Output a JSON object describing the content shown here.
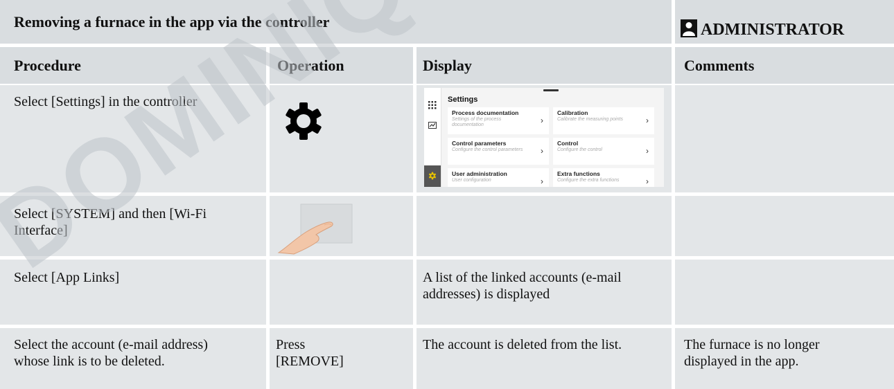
{
  "title": "Removing a furnace in the app via the controller",
  "role": {
    "label": "ADMINISTRATOR",
    "icon": "user-icon"
  },
  "columns": [
    "Procedure",
    "Operation",
    "Display",
    "Comments"
  ],
  "rows": [
    {
      "procedure": "Select [Settings] in the controller",
      "operation": "",
      "operation_icon": "gear-icon",
      "display": "",
      "comments": ""
    },
    {
      "procedure": "Select [SYSTEM] and then [Wi-Fi Interface]",
      "operation": "",
      "operation_icon": "finger-swipe-icon",
      "display": "",
      "comments": ""
    },
    {
      "procedure": "Select [App Links]",
      "operation": "",
      "display": "A list of the linked accounts (e-mail addresses) is displayed",
      "comments": ""
    },
    {
      "procedure": "Select the account (e-mail address) whose link is to be deleted.",
      "operation": "Press [REMOVE]",
      "display": "The account is deleted from the list.",
      "comments": "The furnace is no longer displayed in the app."
    }
  ],
  "settings_screen": {
    "title": "Settings",
    "tiles": [
      {
        "title": "Process documentation",
        "subtitle": "Settings of the process documentation"
      },
      {
        "title": "Calibration",
        "subtitle": "Calibrate the measuring points"
      },
      {
        "title": "Control parameters",
        "subtitle": "Configure the control parameters"
      },
      {
        "title": "Control",
        "subtitle": "Configure the control"
      },
      {
        "title": "User administration",
        "subtitle": "User configuration"
      },
      {
        "title": "Extra functions",
        "subtitle": "Configure the extra functions"
      }
    ]
  },
  "watermark": "DOMINIQUE",
  "colors": {
    "header_bg": "#d9dde0",
    "cell_bg": "#e3e6e8",
    "accent": "#e6c200"
  }
}
